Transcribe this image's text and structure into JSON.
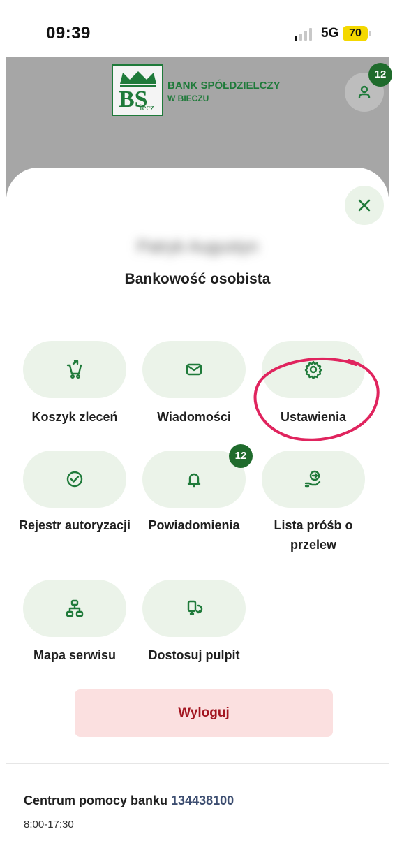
{
  "status_bar": {
    "time": "09:39",
    "network": "5G",
    "battery": "70"
  },
  "header": {
    "logo_letters": "BS",
    "logo_sub": "iecz",
    "bank_name_line1": "BANK SPÓŁDZIELCZY",
    "bank_name_line2": "W BIECZU",
    "notification_count": "12"
  },
  "menu": {
    "user_name": "Patryk Augustyn",
    "segment": "Bankowość osobista",
    "tiles": [
      {
        "label": "Koszyk zleceń",
        "icon": "cart-icon"
      },
      {
        "label": "Wiadomości",
        "icon": "envelope-icon"
      },
      {
        "label": "Ustawienia",
        "icon": "gear-icon"
      },
      {
        "label": "Rejestr autoryzacji",
        "icon": "check-circle-icon"
      },
      {
        "label": "Powiadomienia",
        "icon": "bell-icon",
        "badge": "12"
      },
      {
        "label": "Lista próśb o przelew",
        "icon": "hand-coin-icon"
      },
      {
        "label": "Mapa serwisu",
        "icon": "sitemap-icon"
      },
      {
        "label": "Dostosuj pulpit",
        "icon": "customize-icon"
      }
    ],
    "logout_label": "Wyloguj"
  },
  "help": {
    "label": "Centrum pomocy banku",
    "phone": "134438100",
    "hours": "8:00-17:30"
  },
  "colors": {
    "accent": "#1f7a3a",
    "tile_bg": "#ebf3e9",
    "logout_bg": "#fbe0e0",
    "logout_text": "#a31621",
    "highlight": "#e0245e"
  }
}
